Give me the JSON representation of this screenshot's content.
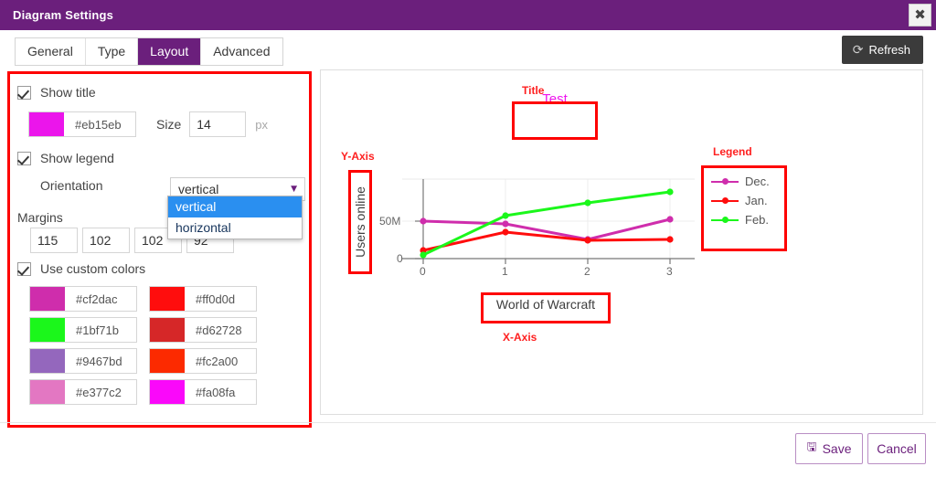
{
  "window": {
    "title": "Diagram Settings",
    "close_icon": "close-icon",
    "close_glyph": "✖"
  },
  "tabs": [
    {
      "label": "General",
      "active": false
    },
    {
      "label": "Type",
      "active": false
    },
    {
      "label": "Layout",
      "active": true
    },
    {
      "label": "Advanced",
      "active": false
    }
  ],
  "toolbar": {
    "refresh_label": "Refresh",
    "refresh_icon": "refresh-icon",
    "refresh_glyph": "⟳"
  },
  "settings": {
    "show_title": {
      "label": "Show title",
      "checked": true,
      "color_value": "#eb15eb",
      "size_label": "Size",
      "size_value": "14",
      "size_unit": "px"
    },
    "show_legend": {
      "label": "Show legend",
      "checked": true,
      "orientation_label": "Orientation",
      "orientation_value": "vertical",
      "orientation_options": [
        "vertical",
        "horizontal"
      ],
      "orientation_selected": "vertical"
    },
    "margins": {
      "label": "Margins",
      "values": [
        "115",
        "102",
        "102",
        "92"
      ]
    },
    "custom_colors": {
      "label": "Use custom colors",
      "checked": true,
      "swatches": [
        {
          "hex": "#cf2dac"
        },
        {
          "hex": "#ff0d0d"
        },
        {
          "hex": "#1bf71b"
        },
        {
          "hex": "#d62728"
        },
        {
          "hex": "#9467bd"
        },
        {
          "hex": "#fc2a00"
        },
        {
          "hex": "#e377c2"
        },
        {
          "hex": "#fa08fa"
        }
      ]
    }
  },
  "annotations": {
    "title": "Title",
    "y_axis": "Y-Axis",
    "x_axis": "X-Axis",
    "legend": "Legend"
  },
  "footer": {
    "save_label": "Save",
    "save_icon": "save-icon",
    "save_glyph": "🖫",
    "cancel_label": "Cancel"
  },
  "chart_data": {
    "type": "line",
    "title": "Test",
    "title_color": "#eb15eb",
    "xlabel": "World of Warcraft",
    "ylabel": "Users online",
    "x": [
      0,
      1,
      2,
      3
    ],
    "xticklabels": [
      "0",
      "1",
      "2",
      "3"
    ],
    "yticklabels": [
      "0",
      "50M"
    ],
    "ylim": [
      0,
      80
    ],
    "ytickvalues": [
      0,
      50
    ],
    "grid": true,
    "legend_position": "right",
    "series": [
      {
        "name": "Dec.",
        "color": "#cf2dac",
        "values": [
          50,
          47,
          26,
          43
        ]
      },
      {
        "name": "Jan.",
        "color": "#ff0d0d",
        "values": [
          11,
          35,
          25,
          26
        ]
      },
      {
        "name": "Feb.",
        "color": "#1bf71b",
        "values": [
          5,
          56,
          66,
          75
        ]
      }
    ]
  }
}
